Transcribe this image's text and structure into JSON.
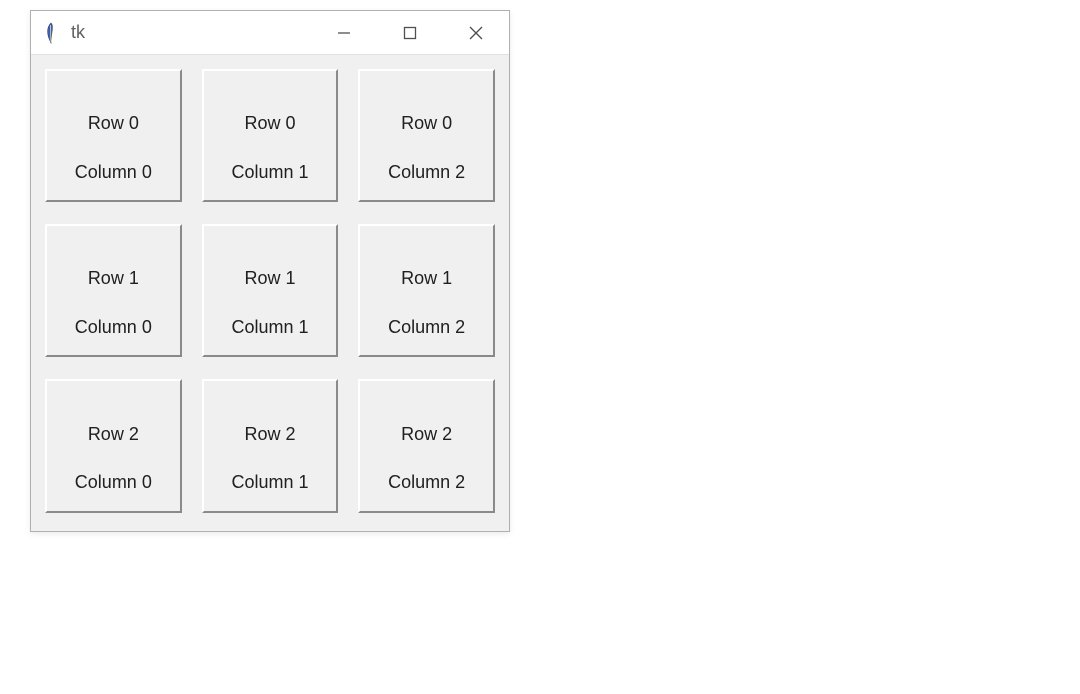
{
  "window": {
    "title": "tk",
    "icon": "feather-icon"
  },
  "controls": {
    "minimize": "Minimize",
    "maximize": "Maximize",
    "close": "Close"
  },
  "grid": {
    "rows": 3,
    "cols": 3,
    "cells": [
      [
        {
          "line1": "Row 0",
          "line2": "Column 0"
        },
        {
          "line1": "Row 0",
          "line2": "Column 1"
        },
        {
          "line1": "Row 0",
          "line2": "Column 2"
        }
      ],
      [
        {
          "line1": "Row 1",
          "line2": "Column 0"
        },
        {
          "line1": "Row 1",
          "line2": "Column 1"
        },
        {
          "line1": "Row 1",
          "line2": "Column 2"
        }
      ],
      [
        {
          "line1": "Row 2",
          "line2": "Column 0"
        },
        {
          "line1": "Row 2",
          "line2": "Column 1"
        },
        {
          "line1": "Row 2",
          "line2": "Column 2"
        }
      ]
    ]
  }
}
